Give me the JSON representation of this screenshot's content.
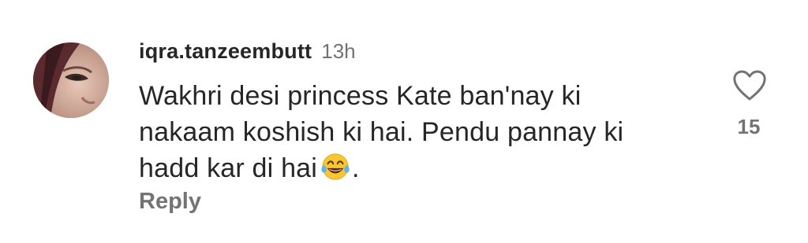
{
  "comment": {
    "username": "iqra.tanzeembutt",
    "timestamp": "13h",
    "text_lines": [
      "Wakhri desi princess Kate ban'nay ki",
      "nakaam koshish ki hai. Pendu pannay ki",
      "hadd kar di hai"
    ],
    "text_end": ".",
    "emoji": "face-with-tears-of-joy",
    "reply_label": "Reply",
    "like_count": "15",
    "like_icon": "heart-outline-icon"
  },
  "colors": {
    "primary_text": "#262626",
    "secondary_text": "#737373",
    "background": "#ffffff"
  }
}
